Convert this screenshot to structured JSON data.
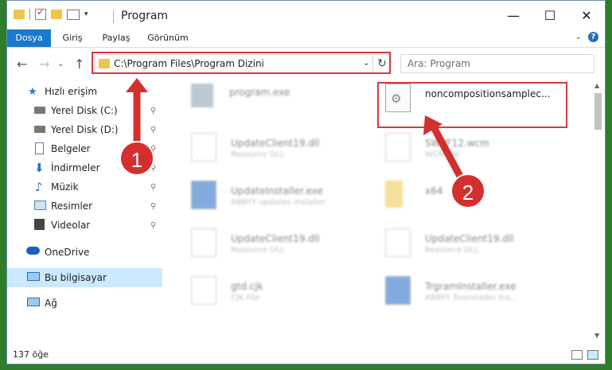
{
  "window": {
    "title": "Program",
    "buttons": {
      "minimize": "—",
      "maximize": "☐",
      "close": "✕"
    }
  },
  "ribbon": {
    "tabs": [
      "Dosya",
      "Giriş",
      "Paylaş",
      "Görünüm"
    ],
    "help": "?"
  },
  "address": {
    "path": "C:\\Program Files\\Program Dizini",
    "search_placeholder": "Ara: Program"
  },
  "sidebar": {
    "items": [
      {
        "label": "Hızlı erişim",
        "icon": "star-icon",
        "pinned": false
      },
      {
        "label": "Yerel Disk (C:)",
        "icon": "drive-icon",
        "pinned": true
      },
      {
        "label": "Yerel Disk (D:)",
        "icon": "drive-icon",
        "pinned": true
      },
      {
        "label": "Belgeler",
        "icon": "document-icon",
        "pinned": true
      },
      {
        "label": "İndirmeler",
        "icon": "download-icon",
        "pinned": true
      },
      {
        "label": "Müzik",
        "icon": "music-icon",
        "pinned": true
      },
      {
        "label": "Resimler",
        "icon": "pictures-icon",
        "pinned": true
      },
      {
        "label": "Videolar",
        "icon": "video-icon",
        "pinned": true
      },
      {
        "label": "OneDrive",
        "icon": "cloud-icon",
        "pinned": false
      },
      {
        "label": "Bu bilgisayar",
        "icon": "computer-icon",
        "pinned": false
      },
      {
        "label": "Ağ",
        "icon": "network-icon",
        "pinned": false
      }
    ],
    "pin_glyph": "📌"
  },
  "files": [
    {
      "name": "program.exe",
      "sub": ""
    },
    {
      "name": "noncompositionsamplec...",
      "sub": ""
    },
    {
      "name": "UpdateClient19.dll",
      "sub": "Resource DLL"
    },
    {
      "name": "SWPF12.wcm",
      "sub": "WCM file"
    },
    {
      "name": "UpdateInstaller.exe",
      "sub": "ABBYY updates installer"
    },
    {
      "name": "x64",
      "sub": ""
    },
    {
      "name": "UpdateClient19.dll",
      "sub": "Resource DLL"
    },
    {
      "name": "UpdateClient19.dll",
      "sub": "Resource DLL"
    },
    {
      "name": "gtd.cjk",
      "sub": "CJK File"
    },
    {
      "name": "TrgramInstaller.exe",
      "sub": "ABBYY fineneader Ins..."
    }
  ],
  "status": {
    "count": "137 öğe"
  },
  "annotations": {
    "step1": "1",
    "step2": "2"
  },
  "colors": {
    "accent": "#1979ca",
    "highlight": "#d93a3a",
    "selected": "#cce8ff"
  }
}
